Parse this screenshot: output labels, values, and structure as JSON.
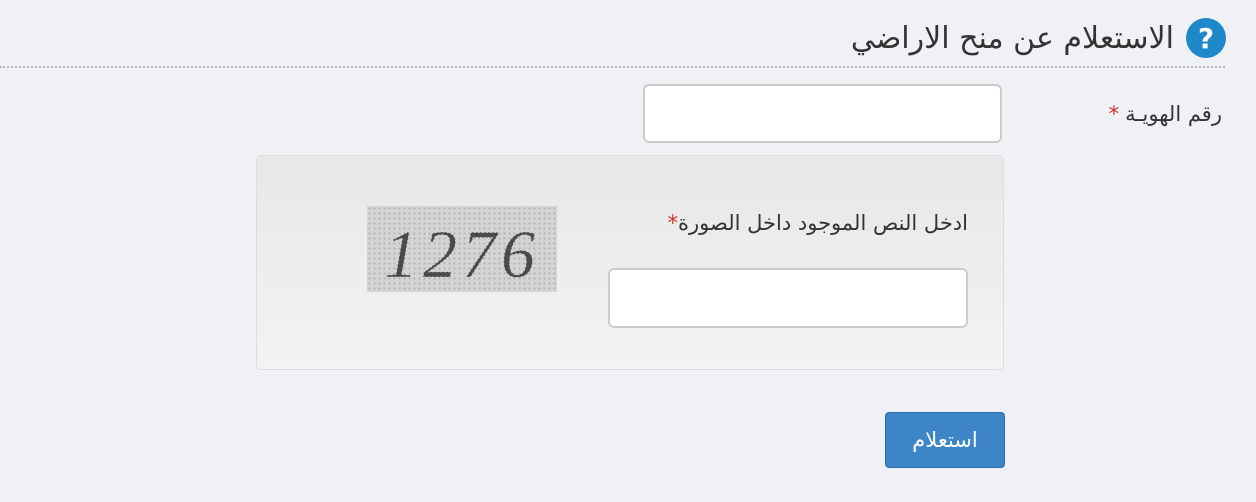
{
  "header": {
    "title": "الاستعلام عن منح الاراضي",
    "help_icon_glyph": "?",
    "icon": "question-circle-icon",
    "icon_color": "#1e88c8"
  },
  "form": {
    "id_field": {
      "label": "رقم الهويـة",
      "required_mark": "*",
      "value": ""
    },
    "captcha": {
      "label": "ادخل النص الموجود داخل الصورة",
      "required_mark": "*",
      "image_text": "1276",
      "value": ""
    },
    "submit_label": "استعلام",
    "accent_color": "#3d85c6",
    "required_color": "#d0312d"
  }
}
